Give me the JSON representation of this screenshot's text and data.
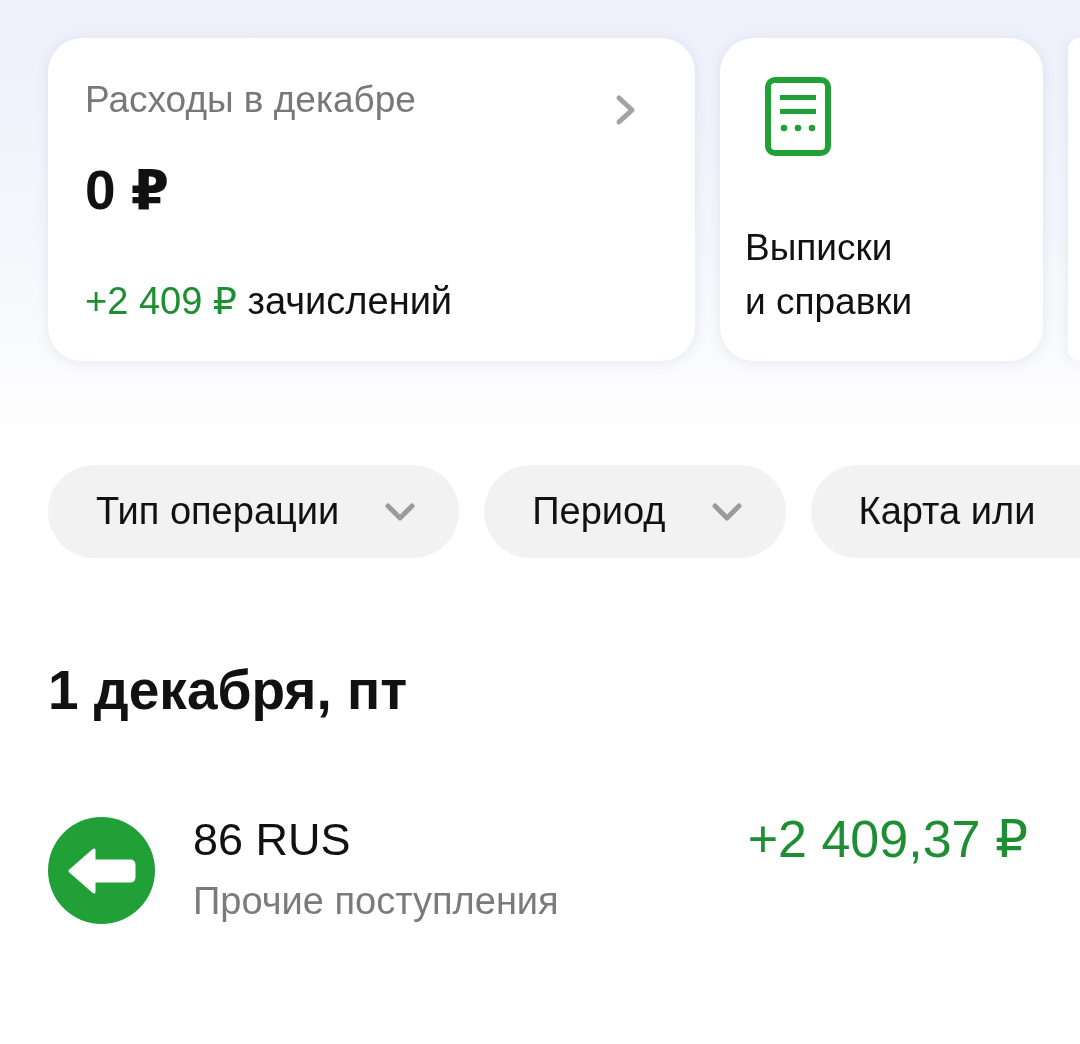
{
  "summary_card": {
    "title": "Расходы в декабре",
    "amount": "0 ₽",
    "income": {
      "amount": "+2 409 ₽",
      "label": "зачислений"
    }
  },
  "statements_card": {
    "label": "Выписки\nи справки"
  },
  "filters": [
    {
      "label": "Тип операции",
      "caret": true
    },
    {
      "label": "Период",
      "caret": true
    },
    {
      "label": "Карта или",
      "caret": false
    }
  ],
  "date_groups": [
    {
      "date": "1 декабря, пт",
      "transactions": [
        {
          "kind": "incoming",
          "name": "86 RUS",
          "category": "Прочие поступления",
          "amount": "+2 409,37 ₽"
        }
      ]
    }
  ]
}
